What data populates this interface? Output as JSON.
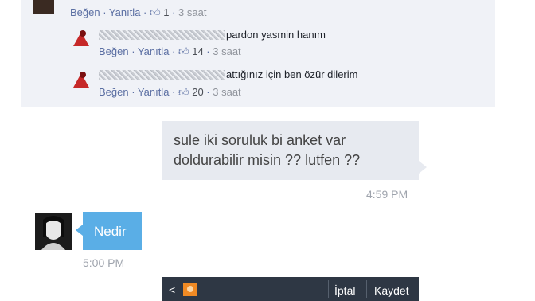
{
  "comments": {
    "top": {
      "like": "Beğen",
      "reply": "Yanıtla",
      "likes": "1",
      "time": "3 saat"
    },
    "replies": [
      {
        "text": "pardon yasmin hanım",
        "like": "Beğen",
        "reply": "Yanıtla",
        "likes": "14",
        "time": "3 saat"
      },
      {
        "text": "attığınız için ben özür dilerim",
        "like": "Beğen",
        "reply": "Yanıtla",
        "likes": "20",
        "time": "3 saat"
      }
    ]
  },
  "chat": {
    "outgoing": {
      "text": "sule iki soruluk bi anket var\ndoldurabilir misin ?? lutfen ??",
      "time": "4:59 PM"
    },
    "incoming": {
      "text": "Nedir",
      "time": "5:00 PM"
    }
  },
  "bottom_bar": {
    "cancel": "İptal",
    "save": "Kaydet"
  },
  "colors": {
    "link": "#5b6fa3",
    "incoming_bubble": "#5aaee6",
    "bar": "#2e3744"
  }
}
